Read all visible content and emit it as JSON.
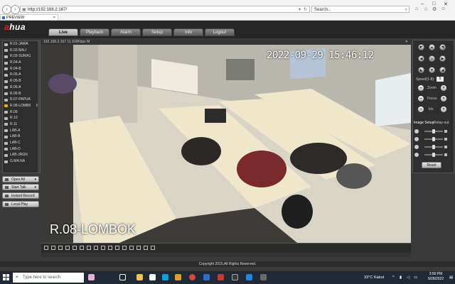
{
  "browser": {
    "url": "http://192.168.2.167/",
    "search_placeholder": "Search...",
    "tab_title": "PREVIEW",
    "tab_close": "×",
    "win_min": "–",
    "win_max": "□",
    "win_close": "✕"
  },
  "app": {
    "logo_a": "a",
    "logo_rest": "hua",
    "tabs": [
      "Live",
      "Playback",
      "Alarm",
      "Setup",
      "Info",
      "Logout"
    ]
  },
  "channels": [
    "R.01-JAWA",
    "R.02-BALI",
    "R.03-SUMA1",
    "R.04-A",
    "R.04-B",
    "R.05-A",
    "R.05-B",
    "R.06-A",
    "R.06-B",
    "R.07-PAPUA",
    "R.08-LOMBK",
    "R.09",
    "R.10",
    "R.11",
    "LAB-A",
    "LAB-B",
    "LAB-C",
    "LAB-D",
    "LAB-JRGN",
    "G.MA.NA"
  ],
  "channel_active_marker": "M",
  "left_buttons": {
    "open_all": "Open All",
    "start_talk": "Start Talk",
    "instant_record": "Instant Record",
    "local_play": "Local Play"
  },
  "video": {
    "info_bar": "192.168.2.167 11 916Kbps M",
    "info_close": "✕",
    "osd_time": "2022-09-29 15:46:12",
    "osd_name": "R.08-LOMBOK"
  },
  "ptz": {
    "speed_label": "Speed(1-8):",
    "speed_value": "5",
    "zoom_label": "Zoom",
    "focus_label": "Focus",
    "iris_label": "Iris",
    "image_setup_label": "Image Setup",
    "relay_out_label": "Relay-out",
    "reset_label": "Reset",
    "minus": "–",
    "plus": "+"
  },
  "footer": {
    "copyright": "Copyright 2015,All Rights Reserved."
  },
  "taskbar": {
    "search_placeholder": "Type here to search",
    "temperature": "33°C  Kabut",
    "time": "3:50 PM",
    "date": "9/28/2022"
  },
  "colors": {
    "accent_red": "#e02424",
    "panel_bg": "#2e2e2e",
    "taskbar_bg": "#1f2a36"
  }
}
